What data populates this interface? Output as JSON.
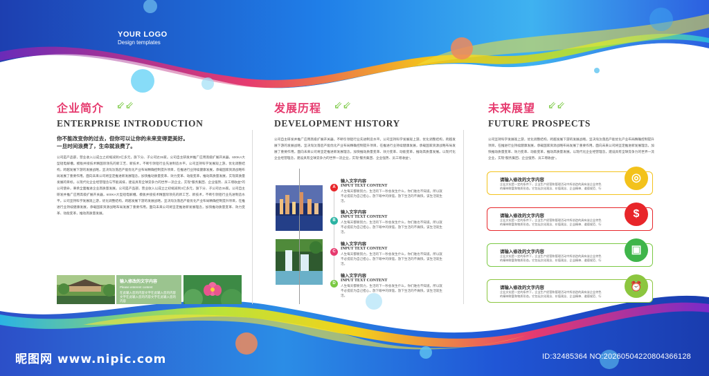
{
  "logo": {
    "title": "YOUR LOGO",
    "subtitle": "Design templates"
  },
  "colors": {
    "blue": "#1a5fd6",
    "pink": "#e63b6f",
    "green": "#7ac943",
    "yellow": "#f3c21b",
    "red": "#e8262a",
    "teal": "#2bb3a3"
  },
  "intro": {
    "title_cn": "企业简介",
    "title_en": "ENTERPRISE INTRODUCTION",
    "lead_1": "你不能改变你的过去，但你可以让你的未来变得更美好。",
    "lead_2": "一旦时间浪费了，生命就浪费了。",
    "body": "公司是产品部，营业收入以成立之初缩减到3亿多元，旗下分、子公司达35家。公司自主研发并推广应用高级扩展开关器，600KA大型短电解槽。模板并接技术精国际领先的新工艺、新技术，不断引领铝行业先进制造水平。公司坚持科学发展观上游，优化调整结构，跨越发展下游的发展战略，坚决淘汰落后产能优化产业布局精确控制提升项目，在推进行业持续健康发展，承载国家资源战略布局发展了重要作用。面向未来公司将坚定推进新发展理念，加快推动质量变革、效力变革、动能变革，推动高质量发展，实现高质量发展的目标。以现代化企业经营理念与节能减排，建设具有全球竞争力的世界一流企业，实现\"服务集团、企业强势、员工增收益\"的公司使命，秉承全面推进企业高质量发展。公司是产品部，营业收入以成立之初缩减到3亿多元，旗下分、子公司达35家。公司自主研发并推广应用高级扩展开关器，600KA大型短电解槽。模板并接技术精国际领先的新工艺、新技术，不断引领铝行业先进制造水平。公司坚持科学发展观上游，优化调整结构，跨越发展下游的发展战略，坚决淘汰落后产能优化产业布局精确控制提升项目，在推进行业持续健康发展，承载国家资源战略布局发展了重要作用。面向未来公司将坚定推进新发展理念，加快推动质量变革、效力变革、动能变革，推动高质量发展。",
    "caption_title": "输入修改的文字内容",
    "caption_en": "Please enterent content",
    "caption_text": "在此输入您的内容文字在此输入您的内容文字在此输入您的内容文字在此输入您的内容"
  },
  "history": {
    "title_cn": "发展历程",
    "title_en": "DEVELOPMENT HISTORY",
    "body": "公司自主研发并推广应用高级扩展开关器，不断引领铝行业先进制造水平。公司坚持科学发展观上游，优化调整结构，跨越发展下游的发展战略，坚决淘汰落后产能优化产业布局精确控制提升项目，在推进行业持续健康发展，承载国家资源战略布局发展了重要作用。面向未来公司将坚定推进新发展理念，加快推动质量变革、效力变革、动能变革，推动高质量发展。以现代化企业经营理念，建设具有全球竞争力的世界一流企业，实现\"服务集团、企业强势、员工增收益\"。",
    "items": [
      {
        "marker": "A",
        "title_cn": "输入文字内容",
        "title_en": "INPUT TEXT CONTENT",
        "text": "人生每天都要努力，生活的下一秒会发生什么，你们谁也不知道。所以就不必提前为自己担心，放下眼中的烦恼，放下生活的不痛快，该生活就生活。",
        "color": "#e8262a"
      },
      {
        "marker": "B",
        "title_cn": "输入文字内容",
        "title_en": "INPUT TEXT CONTENT",
        "text": "人生每天都要努力，生活的下一秒会发生什么，你们谁也不知道。所以就不必提前为自己担心，放下眼中的烦恼，放下生活的不痛快，该生活就生活。",
        "color": "#2bb3a3"
      },
      {
        "marker": "C",
        "title_cn": "输入文字内容",
        "title_en": "INPUT TEXT CONTENT",
        "text": "人生每天都要努力，生活的下一秒会发生什么，你们谁也不知道。所以就不必提前为自己担心，放下眼中的烦恼，放下生活的不痛快，该生活就生活。",
        "color": "#e63b6f"
      },
      {
        "marker": "D",
        "title_cn": "输入文字内容",
        "title_en": "INPUT TEXT CONTENT",
        "text": "人生每天都要努力，生活的下一秒会发生什么，你们谁也不知道。所以就不必提前为自己担心，放下眼中的烦恼，放下生活的不痛快，该生活就生活。",
        "color": "#7ac943"
      }
    ]
  },
  "future": {
    "title_cn": "未来展望",
    "title_en": "FUTURE PROSPECTS",
    "body": "公司坚持科学发展观上游，优化调整结构，跨越发展下游的发展战略，坚决淘汰落后产能优化产业布局精确控制提升项目，在推进行业持续健康发展，承载国家资源战略布局发展了重要作用。面向未来公司将坚定推进新发展理念，加快推动质量变革、效力变革、动能变革，推动高质量发展。以现代化企业经营理念，建设具有全球竞争力的世界一流企业，实现\"服务集团、企业强势、员工增收益\"。",
    "cards": [
      {
        "title": "请输入修改的文字内容",
        "text": "企业文化是一定的条件下，企业生产经营和管理活动中所创造的具有该企业特色的精神财富和物质形态。它包括文化观念、价值观念、企业精神、道德规范、行为准则、历史传统、企业制度、文化环境、企业产品等。其中价值观是企业文化的核心。",
        "icon": "target-icon",
        "glyph": "◎",
        "color": "#f3c21b"
      },
      {
        "title": "请输入修改的文字内容",
        "text": "企业文化是一定的条件下，企业生产经营和管理活动中所创造的具有该企业特色的精神财富和物质形态。它包括文化观念、价值观念、企业精神、道德规范、行为准则、历史传统、企业制度、文化环境、企业产品等。其中价值观是企业文化的核心。",
        "icon": "dollar-icon",
        "glyph": "$",
        "color": "#e8262a"
      },
      {
        "title": "请输入修改的文字内容",
        "text": "企业文化是一定的条件下，企业生产经营和管理活动中所创造的具有该企业特色的精神财富和物质形态。它包括文化观念、价值观念、企业精神、道德规范、行为准则、历史传统、企业制度、文化环境、企业产品等。其中价值观是企业文化的核心。",
        "icon": "gift-icon",
        "glyph": "▣",
        "color": "#7ac943"
      },
      {
        "title": "请输入修改的文字内容",
        "text": "企业文化是一定的条件下，企业生产经营和管理活动中所创造的具有该企业特色的精神财富和物质形态。它包括文化观念、价值观念、企业精神、道德规范、行为准则、历史传统、企业制度、文化环境、企业产品等。其中价值观是企业文化的核心。",
        "icon": "alarm-clock-icon",
        "glyph": "⏰",
        "color": "#8cc63f"
      }
    ]
  },
  "watermark": {
    "site": "昵图网 www.nipic.com",
    "id": "ID:32485364 NO:20260504220804366128"
  }
}
